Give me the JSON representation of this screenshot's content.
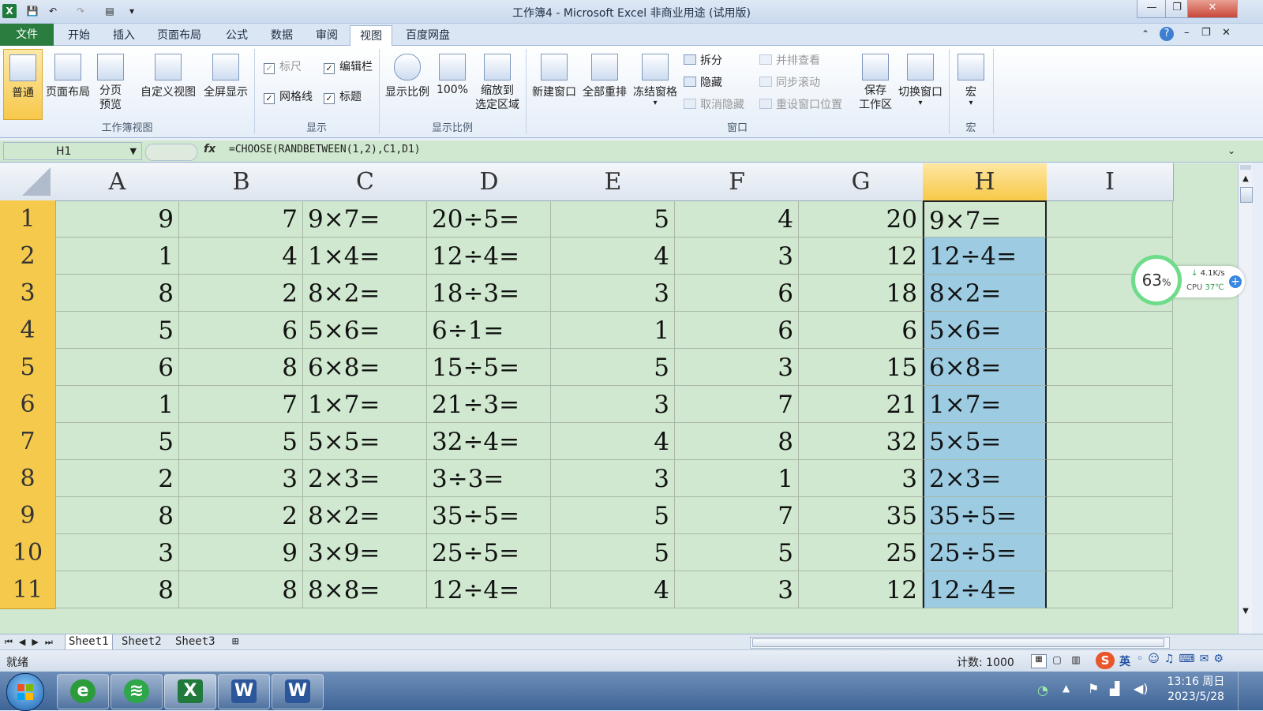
{
  "window": {
    "title": "工作簿4 - Microsoft Excel 非商业用途 (试用版)"
  },
  "ribbon_tabs": [
    "文件",
    "开始",
    "插入",
    "页面布局",
    "公式",
    "数据",
    "审阅",
    "视图",
    "百度网盘"
  ],
  "ribbon": {
    "workbook_views": {
      "label": "工作簿视图",
      "normal": "普通",
      "page_layout": "页面布局",
      "page_break_line1": "分页",
      "page_break_line2": "预览",
      "custom_views": "自定义视图",
      "full_screen": "全屏显示"
    },
    "show": {
      "label": "显示",
      "ruler": "标尺",
      "formula_bar": "编辑栏",
      "gridlines": "网格线",
      "headings": "标题"
    },
    "zoom": {
      "label": "显示比例",
      "zoom": "显示比例",
      "hundred": "100%",
      "zoom_sel_line1": "缩放到",
      "zoom_sel_line2": "选定区域"
    },
    "window": {
      "label": "窗口",
      "new_window": "新建窗口",
      "arrange_all": "全部重排",
      "freeze_panes": "冻结窗格",
      "split": "拆分",
      "hide": "隐藏",
      "unhide": "取消隐藏",
      "side_by_side": "并排查看",
      "sync_scroll": "同步滚动",
      "reset_pos": "重设窗口位置",
      "save_ws_line1": "保存",
      "save_ws_line2": "工作区",
      "switch_windows": "切换窗口"
    },
    "macros": {
      "label": "宏",
      "macros": "宏"
    }
  },
  "formula_bar": {
    "name_box": "H1",
    "fx": "fx",
    "formula": "=CHOOSE(RANDBETWEEN(1,2),C1,D1)"
  },
  "columns": [
    "A",
    "B",
    "C",
    "D",
    "E",
    "F",
    "G",
    "H",
    "I"
  ],
  "rows": [
    {
      "n": "1",
      "A": "9",
      "B": "7",
      "C": "9×7=",
      "D": "20÷5=",
      "E": "5",
      "F": "4",
      "G": "20",
      "H": "9×7="
    },
    {
      "n": "2",
      "A": "1",
      "B": "4",
      "C": "1×4=",
      "D": "12÷4=",
      "E": "4",
      "F": "3",
      "G": "12",
      "H": "12÷4="
    },
    {
      "n": "3",
      "A": "8",
      "B": "2",
      "C": "8×2=",
      "D": "18÷3=",
      "E": "3",
      "F": "6",
      "G": "18",
      "H": "8×2="
    },
    {
      "n": "4",
      "A": "5",
      "B": "6",
      "C": "5×6=",
      "D": "6÷1=",
      "E": "1",
      "F": "6",
      "G": "6",
      "H": "5×6="
    },
    {
      "n": "5",
      "A": "6",
      "B": "8",
      "C": "6×8=",
      "D": "15÷5=",
      "E": "5",
      "F": "3",
      "G": "15",
      "H": "6×8="
    },
    {
      "n": "6",
      "A": "1",
      "B": "7",
      "C": "1×7=",
      "D": "21÷3=",
      "E": "3",
      "F": "7",
      "G": "21",
      "H": "1×7="
    },
    {
      "n": "7",
      "A": "5",
      "B": "5",
      "C": "5×5=",
      "D": "32÷4=",
      "E": "4",
      "F": "8",
      "G": "32",
      "H": "5×5="
    },
    {
      "n": "8",
      "A": "2",
      "B": "3",
      "C": "2×3=",
      "D": "3÷3=",
      "E": "3",
      "F": "1",
      "G": "3",
      "H": "2×3="
    },
    {
      "n": "9",
      "A": "8",
      "B": "2",
      "C": "8×2=",
      "D": "35÷5=",
      "E": "5",
      "F": "7",
      "G": "35",
      "H": "35÷5="
    },
    {
      "n": "10",
      "A": "3",
      "B": "9",
      "C": "3×9=",
      "D": "25÷5=",
      "E": "5",
      "F": "5",
      "G": "25",
      "H": "25÷5="
    },
    {
      "n": "11",
      "A": "8",
      "B": "8",
      "C": "8×8=",
      "D": "12÷4=",
      "E": "4",
      "F": "3",
      "G": "12",
      "H": "12÷4="
    }
  ],
  "sheet_tabs": [
    "Sheet1",
    "Sheet2",
    "Sheet3"
  ],
  "status": {
    "ready": "就绪",
    "count": "计数: 1000"
  },
  "widget": {
    "percent": "63",
    "percent_sign": "%",
    "net": "4.1K/s",
    "cpu_label": "CPU",
    "cpu_temp": "37℃"
  },
  "ime": {
    "lang": "英"
  },
  "clock": {
    "time": "13:16 周日",
    "date": "2023/5/28"
  },
  "colors": {
    "sheet_bg": "#cfe8cf",
    "selected_col": "#9ccbe2",
    "row_header": "#f5c94b",
    "file_tab": "#2a7c3f"
  }
}
